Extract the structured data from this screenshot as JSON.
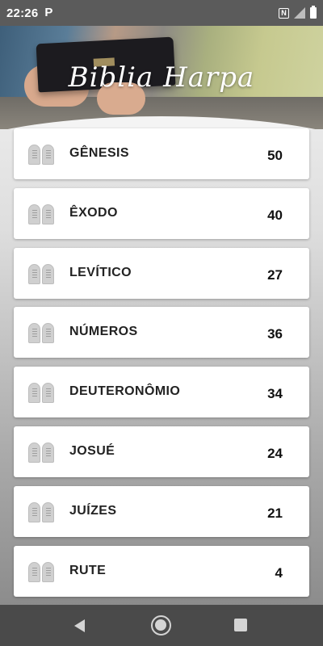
{
  "status_bar": {
    "time": "22:26",
    "notification_icon_label": "P",
    "nfc_icon_label": "N",
    "icons": [
      "parking-icon",
      "nfc-icon",
      "signal-icon",
      "battery-icon"
    ]
  },
  "header": {
    "app_title": "Biblia Harpa"
  },
  "books": [
    {
      "name": "GÊNESIS",
      "chapters": "50"
    },
    {
      "name": "ÊXODO",
      "chapters": "40"
    },
    {
      "name": "LEVÍTICO",
      "chapters": "27"
    },
    {
      "name": "NÚMEROS",
      "chapters": "36"
    },
    {
      "name": "DEUTERONÔMIO",
      "chapters": "34"
    },
    {
      "name": "JOSUÉ",
      "chapters": "24"
    },
    {
      "name": "JUÍZES",
      "chapters": "21"
    },
    {
      "name": "RUTE",
      "chapters": "4"
    }
  ],
  "nav_bar": {
    "icons": [
      "back-icon",
      "home-icon",
      "recents-icon"
    ]
  },
  "colors": {
    "status_bar_bg": "#5b5b5b",
    "card_bg": "#ffffff",
    "nav_bar_bg": "#4a4a4a"
  }
}
